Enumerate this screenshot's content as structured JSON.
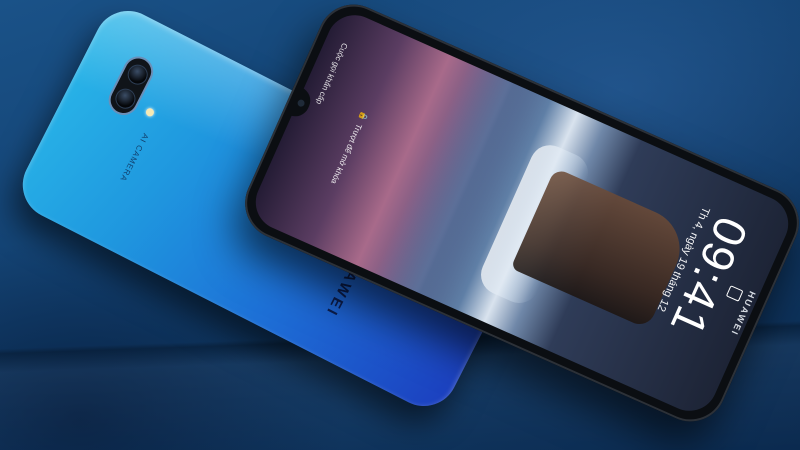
{
  "back_phone": {
    "brand": "HUAWEI",
    "camera_label": "AI CAMERA"
  },
  "front_phone": {
    "brand": "HUAWEI",
    "lock_screen": {
      "status_text": "Cuộc gọi khẩn cấp",
      "swipe_hint": "Trượt để mở khóa",
      "time": "09:41",
      "date": "Th 4, ngày 19 tháng 12"
    }
  },
  "icons": [
    "camera-module-icon",
    "flash-icon",
    "lock-icon",
    "camera-shortcut-icon"
  ],
  "colors": {
    "background": "#123f6e",
    "back_phone_gradient_start": "#29b6e8",
    "back_phone_gradient_end": "#1c3fbf",
    "front_phone_body": "#0b0e12"
  }
}
